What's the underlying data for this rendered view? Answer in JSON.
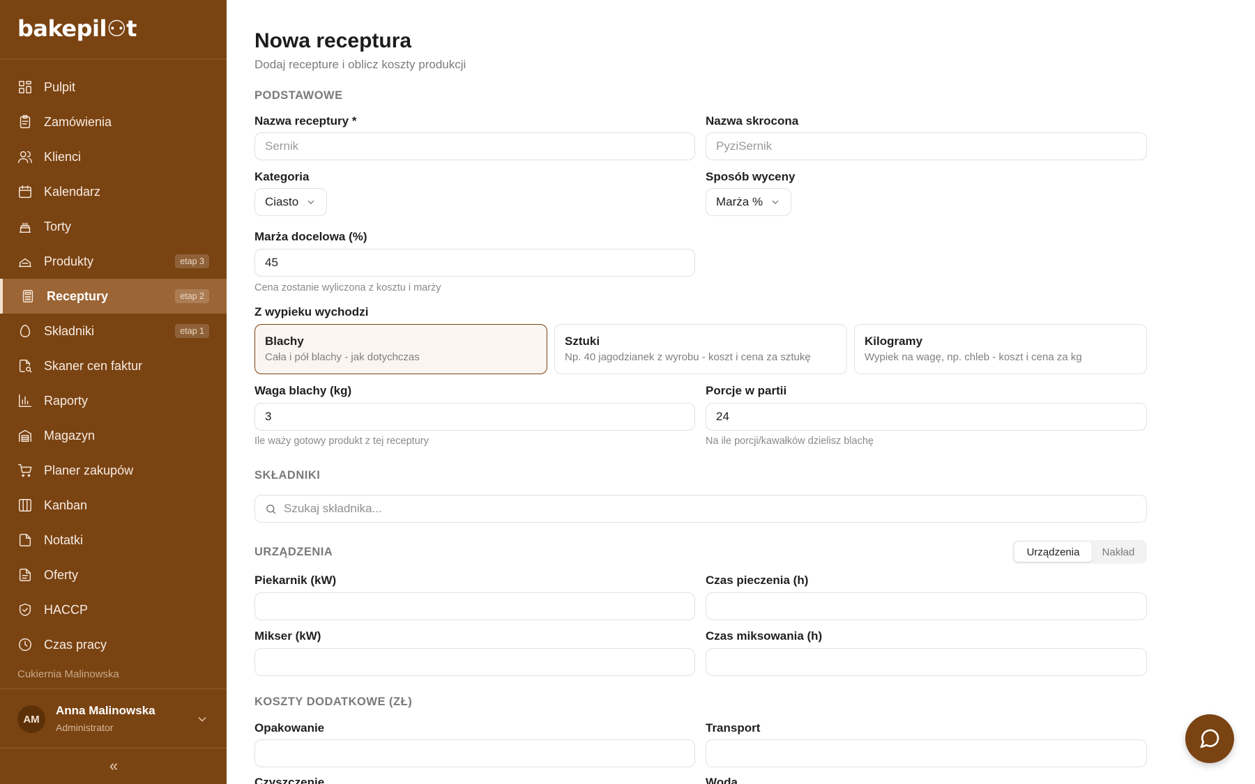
{
  "app": {
    "logo": "bakepil⚇t"
  },
  "sidebar": {
    "items": [
      {
        "label": "Pulpit",
        "icon": "dashboard-icon",
        "badge": ""
      },
      {
        "label": "Zamówienia",
        "icon": "clipboard-icon",
        "badge": ""
      },
      {
        "label": "Klienci",
        "icon": "users-icon",
        "badge": ""
      },
      {
        "label": "Kalendarz",
        "icon": "calendar-icon",
        "badge": ""
      },
      {
        "label": "Torty",
        "icon": "cake-icon",
        "badge": ""
      },
      {
        "label": "Produkty",
        "icon": "product-icon",
        "badge": "etap 3"
      },
      {
        "label": "Receptury",
        "icon": "calculator-icon",
        "badge": "etap 2",
        "active": true
      },
      {
        "label": "Składniki",
        "icon": "egg-icon",
        "badge": "etap 1"
      },
      {
        "label": "Skaner cen faktur",
        "icon": "file-scan-icon",
        "badge": ""
      },
      {
        "label": "Raporty",
        "icon": "bar-chart-icon",
        "badge": ""
      },
      {
        "label": "Magazyn",
        "icon": "warehouse-icon",
        "badge": ""
      },
      {
        "label": "Planer zakupów",
        "icon": "cart-icon",
        "badge": ""
      },
      {
        "label": "Kanban",
        "icon": "kanban-icon",
        "badge": ""
      },
      {
        "label": "Notatki",
        "icon": "note-icon",
        "badge": ""
      },
      {
        "label": "Oferty",
        "icon": "document-icon",
        "badge": ""
      },
      {
        "label": "HACCP",
        "icon": "shield-check-icon",
        "badge": ""
      },
      {
        "label": "Czas pracy",
        "icon": "clock-icon",
        "badge": ""
      }
    ],
    "org_name": "Cukiernia Malinowska",
    "user": {
      "initials": "AM",
      "name": "Anna Malinowska",
      "role": "Administrator"
    },
    "collapse_label": "«"
  },
  "page": {
    "title": "Nowa receptura",
    "subtitle": "Dodaj recepture i oblicz koszty produkcji"
  },
  "basic": {
    "section": "PODSTAWOWE",
    "name_label": "Nazwa receptury *",
    "name_placeholder": "Sernik",
    "short_label": "Nazwa skrocona",
    "short_placeholder": "PyziSernik",
    "category_label": "Kategoria",
    "category_value": "Ciasto",
    "pricing_label": "Sposób wyceny",
    "pricing_value": "Marża %",
    "margin_label": "Marża docelowa (%)",
    "margin_value": "45",
    "margin_help": "Cena zostanie wyliczona z kosztu i marży",
    "yield_label": "Z wypieku wychodzi",
    "yield_options": [
      {
        "title": "Blachy",
        "desc": "Cała i pół blachy - jak dotychczas",
        "selected": true
      },
      {
        "title": "Sztuki",
        "desc": "Np. 40 jagodzianek z wyrobu - koszt i cena za sztukę",
        "selected": false
      },
      {
        "title": "Kilogramy",
        "desc": "Wypiek na wagę, np. chleb - koszt i cena za kg",
        "selected": false
      }
    ],
    "weight_label": "Waga blachy (kg)",
    "weight_value": "3",
    "weight_help": "Ile waży gotowy produkt z tej receptury",
    "portions_label": "Porcje w partii",
    "portions_value": "24",
    "portions_help": "Na ile porcji/kawałków dzielisz blachę"
  },
  "ingredients": {
    "section": "SKŁADNIKI",
    "search_placeholder": "Szukaj składnika..."
  },
  "devices": {
    "section": "URZĄDZENIA",
    "toggle": [
      "Urządzenia",
      "Nakład"
    ],
    "toggle_active": "Urządzenia",
    "oven_label": "Piekarnik (kW)",
    "bake_time_label": "Czas pieczenia (h)",
    "mixer_label": "Mikser (kW)",
    "mix_time_label": "Czas miksowania (h)"
  },
  "extra_costs": {
    "section": "KOSZTY DODATKOWE (ZŁ)",
    "packaging_label": "Opakowanie",
    "transport_label": "Transport",
    "cleaning_label": "Czyszczenie",
    "water_label": "Woda"
  },
  "colors": {
    "sidebar": "#7a4312",
    "active_item": "#9c6535",
    "accent": "#7a4312"
  }
}
